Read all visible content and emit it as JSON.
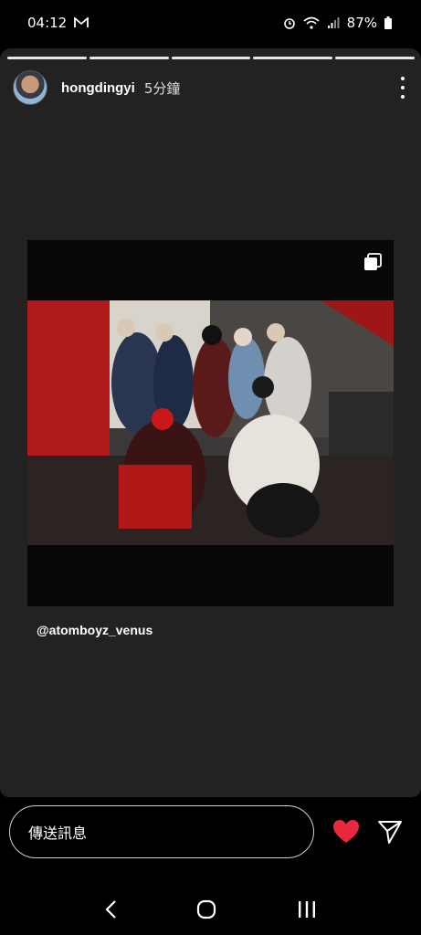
{
  "status_bar": {
    "time": "04:12",
    "mail_icon": "gmail-icon",
    "battery": "87%",
    "icons": [
      "alarm-icon",
      "wifi-icon",
      "signal-icon",
      "battery-icon"
    ]
  },
  "story": {
    "progress_segments": 5,
    "username": "hongdingyi",
    "time_ago": "5分鐘",
    "post_mention": "@atomboyz_venus"
  },
  "reply": {
    "placeholder": "傳送訊息"
  },
  "colors": {
    "heart": "#e8283c",
    "card_bg": "#222222"
  },
  "nav": {
    "icons": [
      "back-icon",
      "home-icon",
      "recents-icon"
    ]
  }
}
